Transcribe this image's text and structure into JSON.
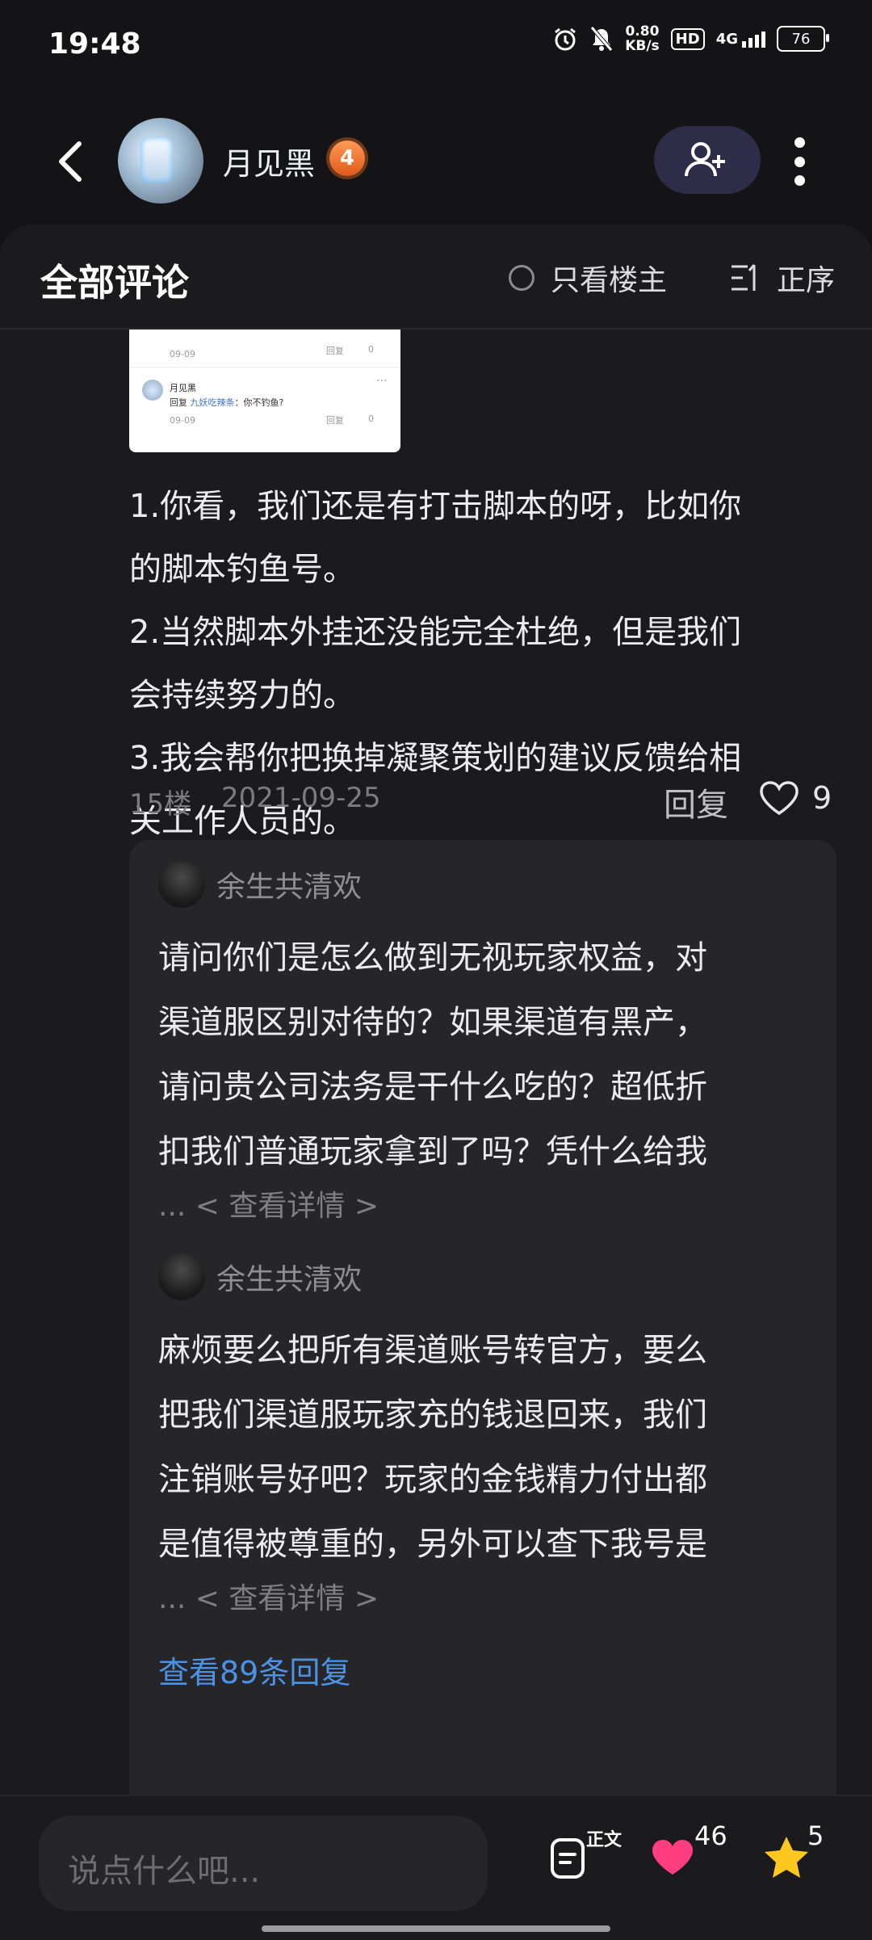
{
  "status_bar": {
    "time": "19:48",
    "speed_value": "0.80",
    "speed_unit": "KB/s",
    "hd": "HD",
    "network": "4G",
    "battery": "76"
  },
  "header": {
    "username": "月见黑",
    "level": "4"
  },
  "comments_panel": {
    "title": "全部评论",
    "owner_only_label": "只看楼主",
    "sort_label": "正序"
  },
  "screenshot_thumb": {
    "date1": "09-09",
    "reply": "回复",
    "likes": "0",
    "name": "月见黑",
    "reply_prefix": "回复",
    "reply_target": "九妖吃辣条",
    "reply_text": "：你不钓鱼?",
    "date2": "09-09",
    "more": "···"
  },
  "comment": {
    "lines": [
      "1.你看，我们还是有打击脚本的呀，比如你",
      "的脚本钓鱼号。",
      "2.当然脚本外挂还没能完全杜绝，但是我们",
      "会持续努力的。",
      "3.我会帮你把换掉凝聚策划的建议反馈给相",
      "关工作人员的。"
    ],
    "floor": "15楼",
    "date": "2021-09-25",
    "reply_label": "回复",
    "like_count": "9"
  },
  "replies": [
    {
      "name": "余生共清欢",
      "lines": [
        "请问你们是怎么做到无视玩家权益，对",
        "渠道服区别对待的？如果渠道有黑产，",
        "请问贵公司法务是干什么吃的？超低折",
        "扣我们普通玩家拿到了吗？凭什么给我"
      ],
      "see_detail": "... < 查看详情 >"
    },
    {
      "name": "余生共清欢",
      "lines": [
        "麻烦要么把所有渠道账号转官方，要么",
        "把我们渠道服玩家充的钱退回来，我们",
        "注销账号好吧？玩家的金钱精力付出都",
        "是值得被尊重的，另外可以查下我号是"
      ],
      "see_detail": "... < 查看详情 >"
    }
  ],
  "view_replies": "查看89条回复",
  "bottom_bar": {
    "input_placeholder": "说点什么吧...",
    "doc_label": "正文",
    "likes": "46",
    "stars": "5"
  },
  "colors": {
    "background": "#141416",
    "panel": "#1b1b1d",
    "reply_card": "#262628",
    "link_blue": "#4b92e6",
    "heart_pink": "#ff3d7f",
    "star_yellow": "#ffc81e",
    "follow_button": "#2f2c4a"
  },
  "icons": [
    "alarm-icon",
    "mute-icon",
    "signal-icon",
    "back-arrow-icon",
    "add-user-icon",
    "more-vertical-icon",
    "sort-icon",
    "heart-outline-icon",
    "document-icon",
    "heart-filled-icon",
    "star-icon"
  ]
}
